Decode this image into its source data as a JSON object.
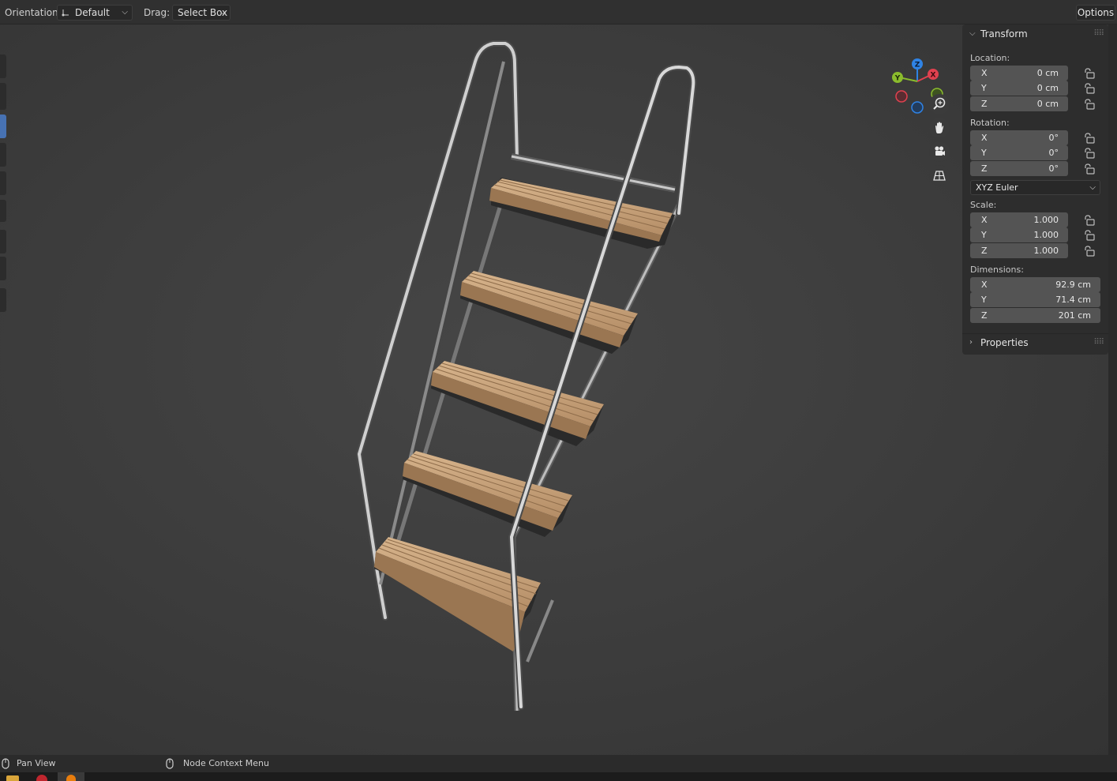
{
  "header": {
    "orientation_label": "Orientation:",
    "orientation_value": "Default",
    "drag_label": "Drag:",
    "drag_value": "Select Box",
    "options_label": "Options"
  },
  "gizmo": {
    "x": "X",
    "y": "Y",
    "z": "Z"
  },
  "transform_panel": {
    "title": "Transform",
    "location_label": "Location:",
    "location": [
      {
        "axis": "X",
        "value": "0 cm"
      },
      {
        "axis": "Y",
        "value": "0 cm"
      },
      {
        "axis": "Z",
        "value": "0 cm"
      }
    ],
    "rotation_label": "Rotation:",
    "rotation": [
      {
        "axis": "X",
        "value": "0°"
      },
      {
        "axis": "Y",
        "value": "0°"
      },
      {
        "axis": "Z",
        "value": "0°"
      }
    ],
    "rotation_mode": "XYZ Euler",
    "scale_label": "Scale:",
    "scale": [
      {
        "axis": "X",
        "value": "1.000"
      },
      {
        "axis": "Y",
        "value": "1.000"
      },
      {
        "axis": "Z",
        "value": "1.000"
      }
    ],
    "dimensions_label": "Dimensions:",
    "dimensions": [
      {
        "axis": "X",
        "value": "92.9 cm"
      },
      {
        "axis": "Y",
        "value": "71.4 cm"
      },
      {
        "axis": "Z",
        "value": "201 cm"
      }
    ]
  },
  "properties_panel": {
    "title": "Properties"
  },
  "statusbar": {
    "left_hint": "Pan View",
    "middle_hint": "Node Context Menu"
  },
  "colors": {
    "accent": "#4772b3",
    "axis_x": "#e0414f",
    "axis_y": "#8bbc2d",
    "axis_z": "#2f83e5",
    "wood": "#c9a47c"
  }
}
